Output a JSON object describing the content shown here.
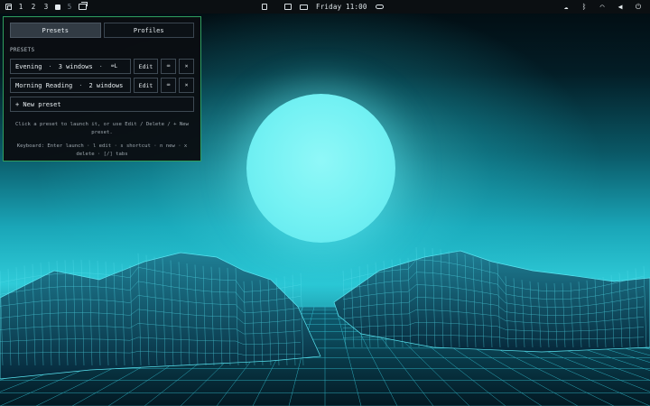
{
  "topbar": {
    "workspaces": [
      "1",
      "2",
      "3",
      "5"
    ],
    "clock": "Friday 11:00",
    "icons": {
      "left": [
        "layout-icon",
        "workspace-filled-icon",
        "windows-icon"
      ],
      "center": [
        "note-icon",
        "monitor-icon",
        "keyboard-icon",
        "cloud-icon"
      ],
      "right": [
        "ghost-icon",
        "bluetooth-icon",
        "wifi-icon",
        "volume-icon",
        "power-icon"
      ]
    }
  },
  "panel": {
    "tabs": [
      {
        "label": "Presets",
        "active": true
      },
      {
        "label": "Profiles",
        "active": false
      }
    ],
    "section_label": "PRESETS",
    "presets": [
      {
        "name": "Evening",
        "sep": "·",
        "windows": "3 windows",
        "sep2": "·",
        "shortcut": "⌨L",
        "edit": "Edit",
        "shortcut_btn": "⌨",
        "delete": "×"
      },
      {
        "name": "Morning Reading",
        "sep": "·",
        "windows": "2 windows",
        "edit": "Edit",
        "shortcut_btn": "⌨",
        "delete": "×"
      }
    ],
    "new_preset": "+ New preset",
    "hint": "Click a preset to launch it, or use Edit / Delete / + New preset.",
    "keyboard_hint": "Keyboard: Enter launch · l edit · s shortcut · n new · x delete · [/] tabs"
  },
  "colors": {
    "panel_border": "#2f9f5f",
    "panel_bg": "#0a0e12",
    "accent_cyan": "#73f1f3"
  }
}
